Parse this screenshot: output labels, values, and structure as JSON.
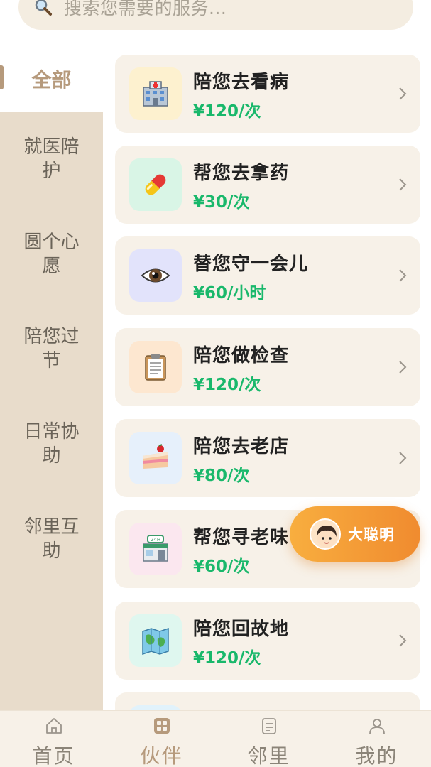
{
  "search": {
    "placeholder": "搜索您需要的服务..."
  },
  "sidebar": {
    "items": [
      {
        "label": "全部",
        "active": true
      },
      {
        "label": "就医陪护"
      },
      {
        "label": "圆个心愿"
      },
      {
        "label": "陪您过节"
      },
      {
        "label": "日常协助"
      },
      {
        "label": "邻里互助"
      }
    ]
  },
  "services": [
    {
      "title": "陪您去看病",
      "price": "¥120/次",
      "icon": "hospital-icon",
      "icon_bg": "#fdf1cf"
    },
    {
      "title": "帮您去拿药",
      "price": "¥30/次",
      "icon": "pill-icon",
      "icon_bg": "#d9f5e6"
    },
    {
      "title": "替您守一会儿",
      "price": "¥60/小时",
      "icon": "eye-icon",
      "icon_bg": "#e2e3fb"
    },
    {
      "title": "陪您做检查",
      "price": "¥120/次",
      "icon": "clipboard-icon",
      "icon_bg": "#fde7d0"
    },
    {
      "title": "陪您去老店",
      "price": "¥80/次",
      "icon": "cake-icon",
      "icon_bg": "#e6f0fb"
    },
    {
      "title": "帮您寻老味",
      "price": "¥60/次",
      "icon": "store-24h-icon",
      "icon_bg": "#fbe7ef"
    },
    {
      "title": "陪您回故地",
      "price": "¥120/次",
      "icon": "map-icon",
      "icon_bg": "#dff7ef"
    }
  ],
  "assistant": {
    "label": "大聪明"
  },
  "tabbar": {
    "items": [
      {
        "label": "首页",
        "icon": "home-icon"
      },
      {
        "label": "伙伴",
        "icon": "grid-icon",
        "active": true
      },
      {
        "label": "邻里",
        "icon": "document-icon"
      },
      {
        "label": "我的",
        "icon": "user-icon"
      }
    ]
  },
  "colors": {
    "accent": "#b69a7c",
    "price": "#19b86b",
    "sidebar_bg": "#e8dccb",
    "card_bg": "#f7f1e8",
    "fab_start": "#f8ae3f",
    "fab_end": "#f08b2f"
  }
}
